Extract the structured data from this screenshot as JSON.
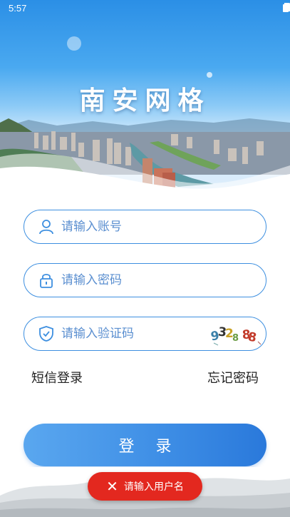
{
  "status_bar": {
    "time": "5:57"
  },
  "app": {
    "title": "南安网格"
  },
  "form": {
    "username_placeholder": "请输入账号",
    "password_placeholder": "请输入密码",
    "captcha_placeholder": "请输入验证码",
    "captcha_text": "932888"
  },
  "links": {
    "sms_login": "短信登录",
    "forgot_password": "忘记密码"
  },
  "login_button": {
    "label": "登录"
  },
  "toast": {
    "message": "请输入用户名",
    "icon": "close-icon"
  },
  "colors": {
    "primary": "#3d8fe0",
    "toast_bg": "#e3281f",
    "placeholder": "#5b8fd0"
  }
}
